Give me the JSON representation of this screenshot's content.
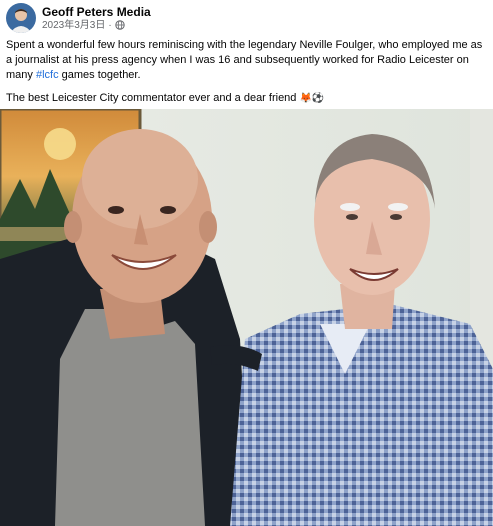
{
  "post": {
    "author": "Geoff Peters Media",
    "date": "2023年3月3日",
    "separator": "·",
    "privacy_icon": "globe-icon",
    "text_line1": "Spent a wonderful few hours reminiscing with the legendary Neville Foulger, who employed me as a journalist at his press agency when I was 16 and subsequently worked for Radio Leicester on many ",
    "hashtag": "#lcfc",
    "text_line1_end": " games together.",
    "text_line2": "The best Leicester City commentator ever and a dear friend ",
    "emojis": "🦊⚽",
    "photo_icon": "photo-two-men"
  },
  "colors": {
    "link": "#216fdb",
    "secondary_text": "#65676b",
    "primary_text": "#050505"
  }
}
